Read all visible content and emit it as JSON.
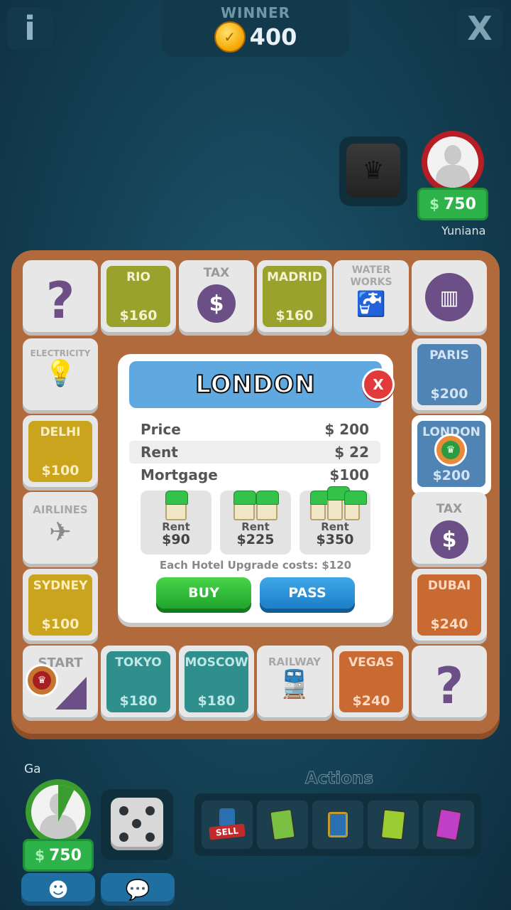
{
  "top": {
    "info_label": "i",
    "close_label": "X",
    "winner_label": "WINNER",
    "winner_amount": "400"
  },
  "opponent": {
    "name": "Yuniana",
    "money": "750"
  },
  "board": {
    "top_row": [
      {
        "kind": "chance"
      },
      {
        "name": "RIO",
        "price": "$160",
        "color": "olive"
      },
      {
        "name": "TAX",
        "icon": "dollar-icon"
      },
      {
        "name": "MADRID",
        "price": "$160",
        "color": "olive"
      },
      {
        "name": "WATER WORKS",
        "icon": "faucet-icon"
      },
      {
        "kind": "jail",
        "icon": "jail-icon"
      }
    ],
    "left_col": [
      {
        "name": "ELECTRICITY",
        "icon": "bulb-icon"
      },
      {
        "name": "DELHI",
        "price": "$100",
        "color": "yellow"
      },
      {
        "name": "AIRLINES",
        "icon": "plane-icon"
      },
      {
        "name": "SYDNEY",
        "price": "$100",
        "color": "yellow"
      }
    ],
    "right_col": [
      {
        "name": "PARIS",
        "price": "$200",
        "color": "blue"
      },
      {
        "name": "LONDON",
        "price": "$200",
        "color": "blue"
      },
      {
        "name": "TAX",
        "icon": "dollar-icon"
      },
      {
        "name": "DUBAI",
        "price": "$240",
        "color": "orange"
      }
    ],
    "bottom_row": [
      {
        "name": "START"
      },
      {
        "name": "TOKYO",
        "price": "$180",
        "color": "teal"
      },
      {
        "name": "MOSCOW",
        "price": "$180",
        "color": "teal"
      },
      {
        "name": "RAILWAY",
        "icon": "train-icon"
      },
      {
        "name": "VEGAS",
        "price": "$240",
        "color": "orange"
      },
      {
        "kind": "chance"
      }
    ]
  },
  "popup": {
    "title": "LONDON",
    "close": "X",
    "rows": [
      {
        "label": "Price",
        "value": "$ 200"
      },
      {
        "label": "Rent",
        "value": "$ 22"
      },
      {
        "label": "Mortgage",
        "value": "$100"
      }
    ],
    "rents": [
      {
        "label": "Rent",
        "value": "$90"
      },
      {
        "label": "Rent",
        "value": "$225"
      },
      {
        "label": "Rent",
        "value": "$350"
      }
    ],
    "upgrade_note": "Each Hotel Upgrade costs: $120",
    "buy_label": "BUY",
    "pass_label": "PASS"
  },
  "player": {
    "name": "Ga",
    "money": "750",
    "dice_value": 5
  },
  "actions": {
    "title": "Actions",
    "sell_label": "SELL"
  },
  "colors": {
    "board": "#b06a3c",
    "buy": "#2fbf3a",
    "pass": "#2a8fd8",
    "london": "#5fa8e0"
  }
}
